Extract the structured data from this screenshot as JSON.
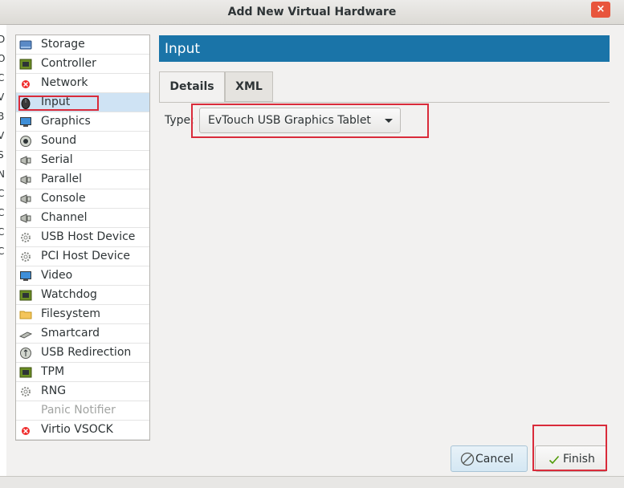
{
  "window": {
    "title": "Add New Virtual Hardware",
    "close_glyph": "×"
  },
  "edge_letters": [
    "D",
    "O",
    "C",
    "V",
    "B",
    "V",
    "S",
    "N",
    "C",
    "C",
    "C",
    "C"
  ],
  "sidebar": {
    "items": [
      {
        "label": "Storage",
        "icon": "storage-icon"
      },
      {
        "label": "Controller",
        "icon": "controller-icon"
      },
      {
        "label": "Network",
        "icon": "network-icon"
      },
      {
        "label": "Input",
        "icon": "input-icon",
        "selected": true
      },
      {
        "label": "Graphics",
        "icon": "graphics-icon"
      },
      {
        "label": "Sound",
        "icon": "sound-icon"
      },
      {
        "label": "Serial",
        "icon": "serial-icon"
      },
      {
        "label": "Parallel",
        "icon": "parallel-icon"
      },
      {
        "label": "Console",
        "icon": "console-icon"
      },
      {
        "label": "Channel",
        "icon": "channel-icon"
      },
      {
        "label": "USB Host Device",
        "icon": "usb-host-device-icon"
      },
      {
        "label": "PCI Host Device",
        "icon": "pci-host-device-icon"
      },
      {
        "label": "Video",
        "icon": "video-icon"
      },
      {
        "label": "Watchdog",
        "icon": "watchdog-icon"
      },
      {
        "label": "Filesystem",
        "icon": "filesystem-icon"
      },
      {
        "label": "Smartcard",
        "icon": "smartcard-icon"
      },
      {
        "label": "USB Redirection",
        "icon": "usb-redirection-icon"
      },
      {
        "label": "TPM",
        "icon": "tpm-icon"
      },
      {
        "label": "RNG",
        "icon": "rng-icon"
      },
      {
        "label": "Panic Notifier",
        "icon": "panic-notifier-icon",
        "disabled": true
      },
      {
        "label": "Virtio VSOCK",
        "icon": "virtio-vsock-icon"
      }
    ]
  },
  "main": {
    "header": "Input",
    "tabs": [
      {
        "label": "Details",
        "active": true
      },
      {
        "label": "XML",
        "active": false
      }
    ],
    "type_label": "Type:",
    "type_value": "EvTouch USB Graphics Tablet"
  },
  "buttons": {
    "cancel": "Cancel",
    "finish": "Finish"
  },
  "colors": {
    "header_bg": "#1a74a8",
    "selected_row": "#cfe3f4",
    "highlight_box": "#d92b3a",
    "close_bg": "#e8553c"
  }
}
